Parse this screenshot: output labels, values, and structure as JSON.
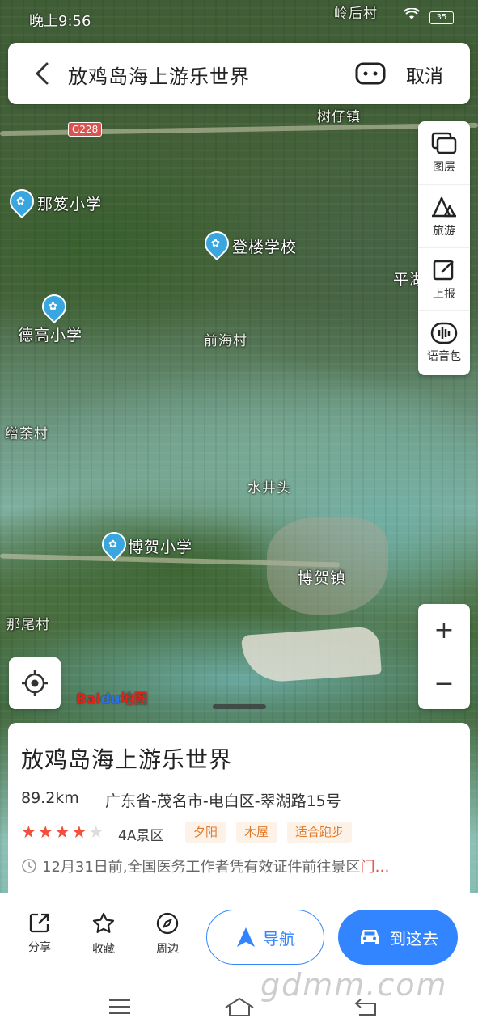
{
  "status_bar": {
    "time": "晚上9:56",
    "battery": "35"
  },
  "search": {
    "query": "放鸡岛海上游乐世界",
    "cancel_label": "取消"
  },
  "map_labels": [
    {
      "id": "label-lingcun",
      "text": "岭后村"
    },
    {
      "id": "label-shuzai",
      "text": "树仔镇"
    },
    {
      "id": "label-g228",
      "text": "G228"
    },
    {
      "id": "label-nali",
      "text": "那笈小学"
    },
    {
      "id": "label-denglou",
      "text": "登楼学校"
    },
    {
      "id": "label-pinghu",
      "text": "平湖"
    },
    {
      "id": "label-degao",
      "text": "德高小学"
    },
    {
      "id": "label-qianhai",
      "text": "前海村"
    },
    {
      "id": "label-xiemu",
      "text": "缯荼村"
    },
    {
      "id": "label-shuijing",
      "text": "水井头"
    },
    {
      "id": "label-bohe-school",
      "text": "博贺小学"
    },
    {
      "id": "label-bohe-town",
      "text": "博贺镇"
    },
    {
      "id": "label-nawei",
      "text": "那尾村"
    }
  ],
  "right_tools": [
    {
      "label": "图层",
      "icon": "layers-icon"
    },
    {
      "label": "旅游",
      "icon": "travel-icon"
    },
    {
      "label": "上报",
      "icon": "report-icon"
    },
    {
      "label": "语音包",
      "icon": "voice-pack-icon"
    }
  ],
  "zoom": {
    "in": "+",
    "out": "−"
  },
  "baidu_logo": {
    "bai": "Bai",
    "du": "du",
    "map": "地图"
  },
  "place": {
    "title": "放鸡岛海上游乐世界",
    "distance": "89.2km",
    "address": "广东省-茂名市-电白区-翠湖路15号",
    "rating_stars": 4,
    "rating_max": 5,
    "level": "4A景区",
    "tags": [
      "夕阳",
      "木屋",
      "适合跑步"
    ],
    "notice": "12月31日前,全国医务工作者凭有效证件前往景区",
    "notice_more": "门…"
  },
  "actions": {
    "share": "分享",
    "favorite": "收藏",
    "nearby": "周边",
    "navigate": "导航",
    "go_here": "到这去"
  },
  "watermark": "gdmm.com",
  "colors": {
    "accent": "#3385ff",
    "tag_bg": "#fdf2e7",
    "tag_text": "#e07a2b",
    "star": "#f0503c"
  }
}
